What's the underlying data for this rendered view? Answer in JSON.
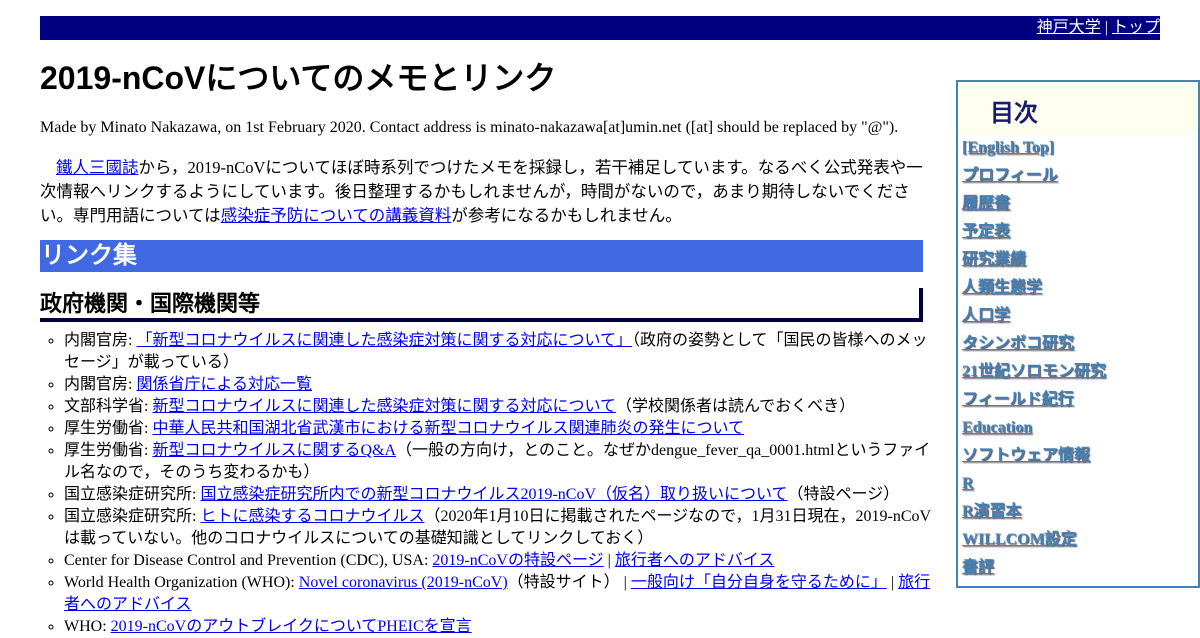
{
  "topbar": {
    "univ": "神戸大学",
    "sep": " | ",
    "top": "トップ"
  },
  "title": "2019-nCoVについてのメモとリンク",
  "meta": "Made by Minato Nakazawa, on 1st February 2020. Contact address is minato-nakazawa[at]umin.net ([at] should be replaced by \"@\").",
  "intro": {
    "link1": "鐵人三國誌",
    "text1": "から，2019-nCoVについてほぼ時系列でつけたメモを採録し，若干補足しています。なるべく公式発表や一次情報へリンクするようにしています。後日整理するかもしれませんが，時間がないので，あまり期待しないでください。専門用語については",
    "link2": "感染症予防についての講義資料",
    "text2": "が参考になるかもしれません。"
  },
  "section": "リンク集",
  "subsection": "政府機関・国際機関等",
  "items": [
    {
      "pre": "内閣官房: ",
      "link": "「新型コロナウイルスに関連した感染症対策に関する対応について」",
      "post": "（政府の姿勢として「国民の皆様へのメッセージ」が載っている）"
    },
    {
      "pre": "内閣官房: ",
      "link": "関係省庁による対応一覧",
      "post": ""
    },
    {
      "pre": "文部科学省: ",
      "link": "新型コロナウイルスに関連した感染症対策に関する対応について",
      "post": "（学校関係者は読んでおくべき）"
    },
    {
      "pre": "厚生労働省: ",
      "link": "中華人民共和国湖北省武漢市における新型コロナウイルス関連肺炎の発生について",
      "post": ""
    },
    {
      "pre": "厚生労働省: ",
      "link": "新型コロナウイルスに関するQ&A",
      "post": "（一般の方向け，とのこと。なぜかdengue_fever_qa_0001.htmlというファイル名なので，そのうち変わるかも）"
    },
    {
      "pre": "国立感染症研究所: ",
      "link": "国立感染症研究所内での新型コロナウイルス2019-nCoV（仮名）取り扱いについて",
      "post": "（特設ページ）"
    },
    {
      "pre": "国立感染症研究所: ",
      "link": "ヒトに感染するコロナウイルス",
      "post": "（2020年1月10日に掲載されたページなので，1月31日現在，2019-nCoVは載っていない。他のコロナウイルスについての基礎知識としてリンクしておく）"
    },
    {
      "pre": "Center for Disease Control and Prevention (CDC), USA: ",
      "link": "2019-nCoVの特設ページ",
      "mid": " | ",
      "link2": "旅行者へのアドバイス",
      "post": ""
    },
    {
      "pre": "World Health Organization (WHO): ",
      "link": "Novel coronavirus (2019-nCoV)",
      "mid": "（特設サイト） | ",
      "link2": "一般向け「自分自身を守るために」",
      "mid2": " | ",
      "link3": "旅行者へのアドバイス",
      "post": ""
    },
    {
      "pre": "WHO: ",
      "link": "2019-nCoVのアウトブレイクについてPHEICを宣言",
      "post": ""
    }
  ],
  "sidebar": {
    "title": "目次",
    "items": [
      "[English Top]",
      "プロフィール",
      "履歴書",
      "予定表",
      "研究業績",
      "人類生態学",
      "人口学",
      "タシンボコ研究",
      "21世紀ソロモン研究",
      "フィールド紀行",
      "Education",
      "ソフトウェア情報",
      "R",
      "R演習本",
      "WILLCOM設定",
      "書評"
    ]
  }
}
